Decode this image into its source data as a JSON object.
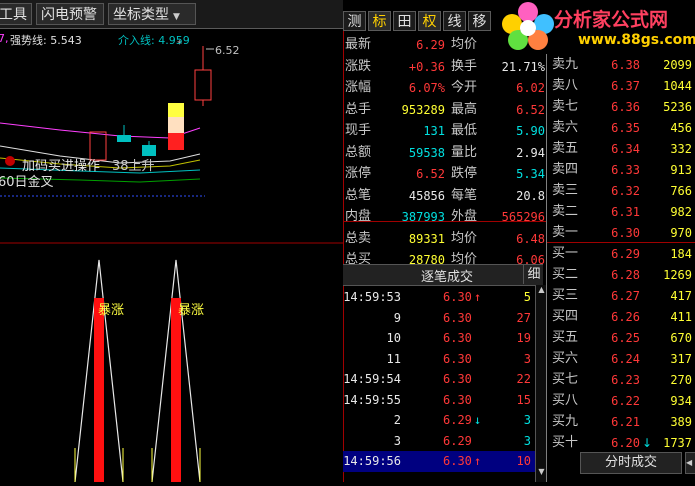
{
  "toolbar": {
    "items": [
      {
        "label": "工具"
      },
      {
        "label": "闪电预警"
      },
      {
        "label": "坐标类型"
      }
    ]
  },
  "chart": {
    "legend": [
      {
        "label": "强势线: 5.543",
        "color": "#e0e0e0"
      },
      {
        "label": "介入线: 4.959",
        "color": "#00c0c0"
      }
    ],
    "legend_prefix": "7,",
    "price_label": "6.52",
    "overlay_texts": [
      "加码买进操作",
      "38上升",
      "60日金叉"
    ],
    "burst_labels": [
      "暴涨",
      "暴涨"
    ]
  },
  "quote_tabs": [
    {
      "label": "测",
      "active": false
    },
    {
      "label": "标",
      "active": true
    },
    {
      "label": "田",
      "active": false
    },
    {
      "label": "权",
      "active": true
    },
    {
      "label": "线",
      "active": false
    },
    {
      "label": "移",
      "active": false
    }
  ],
  "watermark": {
    "name": "分析家公式网",
    "url": "www.88gs.com"
  },
  "quote": [
    {
      "l1": "最新",
      "v1": "6.29",
      "c1": "red",
      "l2": "均价",
      "v2": "",
      "c2": "red"
    },
    {
      "l1": "涨跌",
      "v1": "+0.36",
      "c1": "red",
      "l2": "换手",
      "v2": "21.71%",
      "c2": "wht"
    },
    {
      "l1": "涨幅",
      "v1": "6.07%",
      "c1": "red",
      "l2": "今开",
      "v2": "6.02",
      "c2": "red"
    },
    {
      "l1": "总手",
      "v1": "953289",
      "c1": "yel",
      "l2": "最高",
      "v2": "6.52",
      "c2": "red"
    },
    {
      "l1": "现手",
      "v1": "131",
      "c1": "grn",
      "l2": "最低",
      "v2": "5.90",
      "c2": "grn"
    },
    {
      "l1": "总额",
      "v1": "59538",
      "c1": "grn",
      "l2": "量比",
      "v2": "2.94",
      "c2": "wht"
    },
    {
      "l1": "涨停",
      "v1": "6.52",
      "c1": "red",
      "l2": "跌停",
      "v2": "5.34",
      "c2": "grn"
    },
    {
      "l1": "总笔",
      "v1": "45856",
      "c1": "wht",
      "l2": "每笔",
      "v2": "20.8",
      "c2": "wht"
    },
    {
      "l1": "内盘",
      "v1": "387993",
      "c1": "grn",
      "l2": "外盘",
      "v2": "565296",
      "c2": "red"
    },
    {
      "l1": "总卖",
      "v1": "89331",
      "c1": "yel",
      "l2": "均价",
      "v2": "6.48",
      "c2": "red"
    },
    {
      "l1": "总买",
      "v1": "28780",
      "c1": "yel",
      "l2": "均价",
      "v2": "6.06",
      "c2": "red"
    }
  ],
  "ticks_header": {
    "title": "逐笔成交",
    "detail": "细"
  },
  "ticks": [
    {
      "time": "14:59:53",
      "price": "6.30",
      "dir": "↑",
      "vol": "5",
      "pc": "red",
      "vc": "yel",
      "sel": false
    },
    {
      "time": "9",
      "price": "6.30",
      "dir": "",
      "vol": "27",
      "pc": "red",
      "vc": "red",
      "sel": false
    },
    {
      "time": "10",
      "price": "6.30",
      "dir": "",
      "vol": "19",
      "pc": "red",
      "vc": "red",
      "sel": false
    },
    {
      "time": "11",
      "price": "6.30",
      "dir": "",
      "vol": "3",
      "pc": "red",
      "vc": "red",
      "sel": false
    },
    {
      "time": "14:59:54",
      "price": "6.30",
      "dir": "",
      "vol": "22",
      "pc": "red",
      "vc": "red",
      "sel": false
    },
    {
      "time": "14:59:55",
      "price": "6.30",
      "dir": "",
      "vol": "15",
      "pc": "red",
      "vc": "red",
      "sel": false
    },
    {
      "time": "2",
      "price": "6.29",
      "dir": "↓",
      "vol": "3",
      "pc": "red",
      "vc": "grn",
      "sel": false
    },
    {
      "time": "3",
      "price": "6.29",
      "dir": "",
      "vol": "3",
      "pc": "red",
      "vc": "grn",
      "sel": false
    },
    {
      "time": "14:59:56",
      "price": "6.30",
      "dir": "↑",
      "vol": "10",
      "pc": "red",
      "vc": "red",
      "sel": true
    }
  ],
  "sells": [
    {
      "name": "卖九",
      "price": "6.38",
      "vol": "2099"
    },
    {
      "name": "卖八",
      "price": "6.37",
      "vol": "1044"
    },
    {
      "name": "卖七",
      "price": "6.36",
      "vol": "5236"
    },
    {
      "name": "卖六",
      "price": "6.35",
      "vol": "456"
    },
    {
      "name": "卖五",
      "price": "6.34",
      "vol": "332"
    },
    {
      "name": "卖四",
      "price": "6.33",
      "vol": "913"
    },
    {
      "name": "卖三",
      "price": "6.32",
      "vol": "766"
    },
    {
      "name": "卖二",
      "price": "6.31",
      "vol": "982"
    },
    {
      "name": "卖一",
      "price": "6.30",
      "vol": "970"
    }
  ],
  "buys": [
    {
      "name": "买一",
      "price": "6.29",
      "vol": "184"
    },
    {
      "name": "买二",
      "price": "6.28",
      "vol": "1269"
    },
    {
      "name": "买三",
      "price": "6.27",
      "vol": "417"
    },
    {
      "name": "买四",
      "price": "6.26",
      "vol": "411"
    },
    {
      "name": "买五",
      "price": "6.25",
      "vol": "670"
    },
    {
      "name": "买六",
      "price": "6.24",
      "vol": "317"
    },
    {
      "name": "买七",
      "price": "6.23",
      "vol": "270"
    },
    {
      "name": "买八",
      "price": "6.22",
      "vol": "934"
    },
    {
      "name": "买九",
      "price": "6.21",
      "vol": "389"
    },
    {
      "name": "买十",
      "price": "6.20",
      "vol": "1737",
      "dir": "↓"
    }
  ],
  "timeshare_tab": {
    "label": "分时成交"
  }
}
